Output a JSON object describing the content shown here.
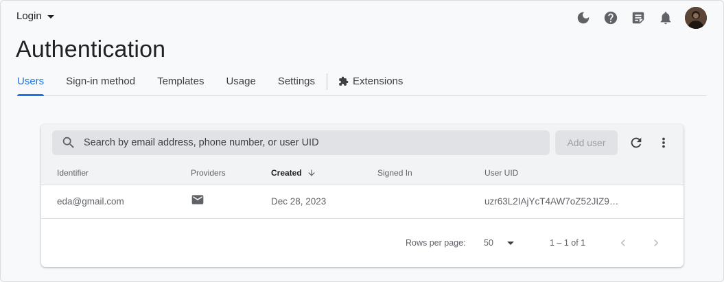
{
  "header": {
    "project_label": "Login"
  },
  "top_icons": [
    "moon-icon",
    "help-icon",
    "notes-icon",
    "bell-icon"
  ],
  "page": {
    "title": "Authentication"
  },
  "tabs": [
    {
      "label": "Users",
      "active": true
    },
    {
      "label": "Sign-in method"
    },
    {
      "label": "Templates"
    },
    {
      "label": "Usage"
    },
    {
      "label": "Settings"
    },
    {
      "label": "Extensions"
    }
  ],
  "toolbar": {
    "search_placeholder": "Search by email address, phone number, or user UID",
    "add_user_label": "Add user"
  },
  "table": {
    "columns": [
      "Identifier",
      "Providers",
      "Created",
      "Signed In",
      "User UID"
    ],
    "sorted_column": "Created",
    "rows": [
      {
        "identifier": "eda@gmail.com",
        "provider": "email-icon",
        "created": "Dec 28, 2023",
        "signed_in": "",
        "uid": "uzr63L2IAjYcT4AW7oZ52JIZ9…"
      }
    ]
  },
  "pagination": {
    "rows_per_page_label": "Rows per page:",
    "rows_per_page_value": "50",
    "range_text": "1 – 1 of 1"
  },
  "colors": {
    "accent": "#1a73e8",
    "text": "#202124",
    "muted": "#5f6368",
    "icon": "#5f6368"
  }
}
